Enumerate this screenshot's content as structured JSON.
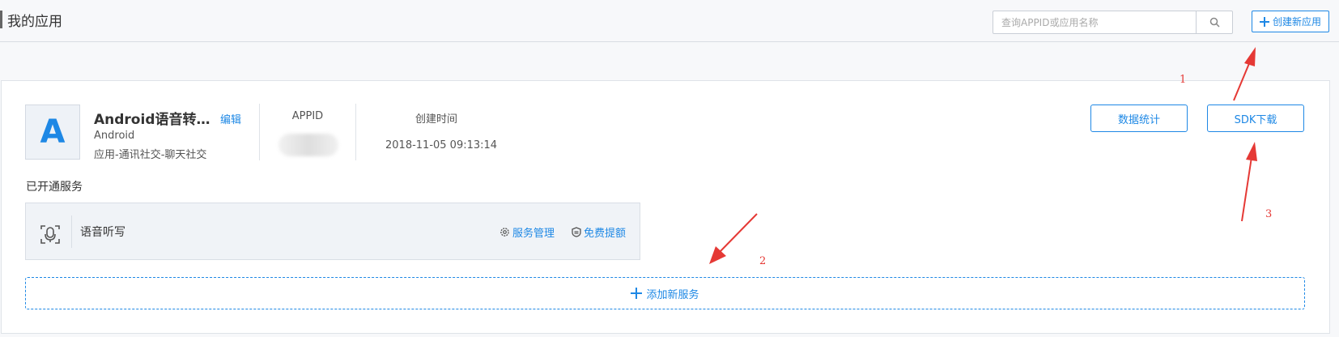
{
  "header": {
    "title": "我的应用",
    "search_placeholder": "查询APPID或应用名称",
    "create_button_label": "创建新应用"
  },
  "app": {
    "avatar_letter": "A",
    "name": "Android语音转…",
    "edit_label": "编辑",
    "platform": "Android",
    "category": "应用-通讯社交-聊天社交",
    "appid_label": "APPID",
    "created_label": "创建时间",
    "created_value": "2018-11-05 09:13:14",
    "stats_button_label": "数据统计",
    "sdk_button_label": "SDK下载"
  },
  "services": {
    "section_label": "已开通服务",
    "items": [
      {
        "name": "语音听写",
        "icon": "mic-icon",
        "manage_label": "服务管理",
        "quota_label": "免费提额"
      }
    ],
    "add_label": "添加新服务"
  },
  "annotations": {
    "labels": [
      "1",
      "2",
      "3"
    ],
    "color": "#e53935"
  },
  "colors": {
    "accent": "#1e88e5",
    "annotation": "#e53935"
  }
}
